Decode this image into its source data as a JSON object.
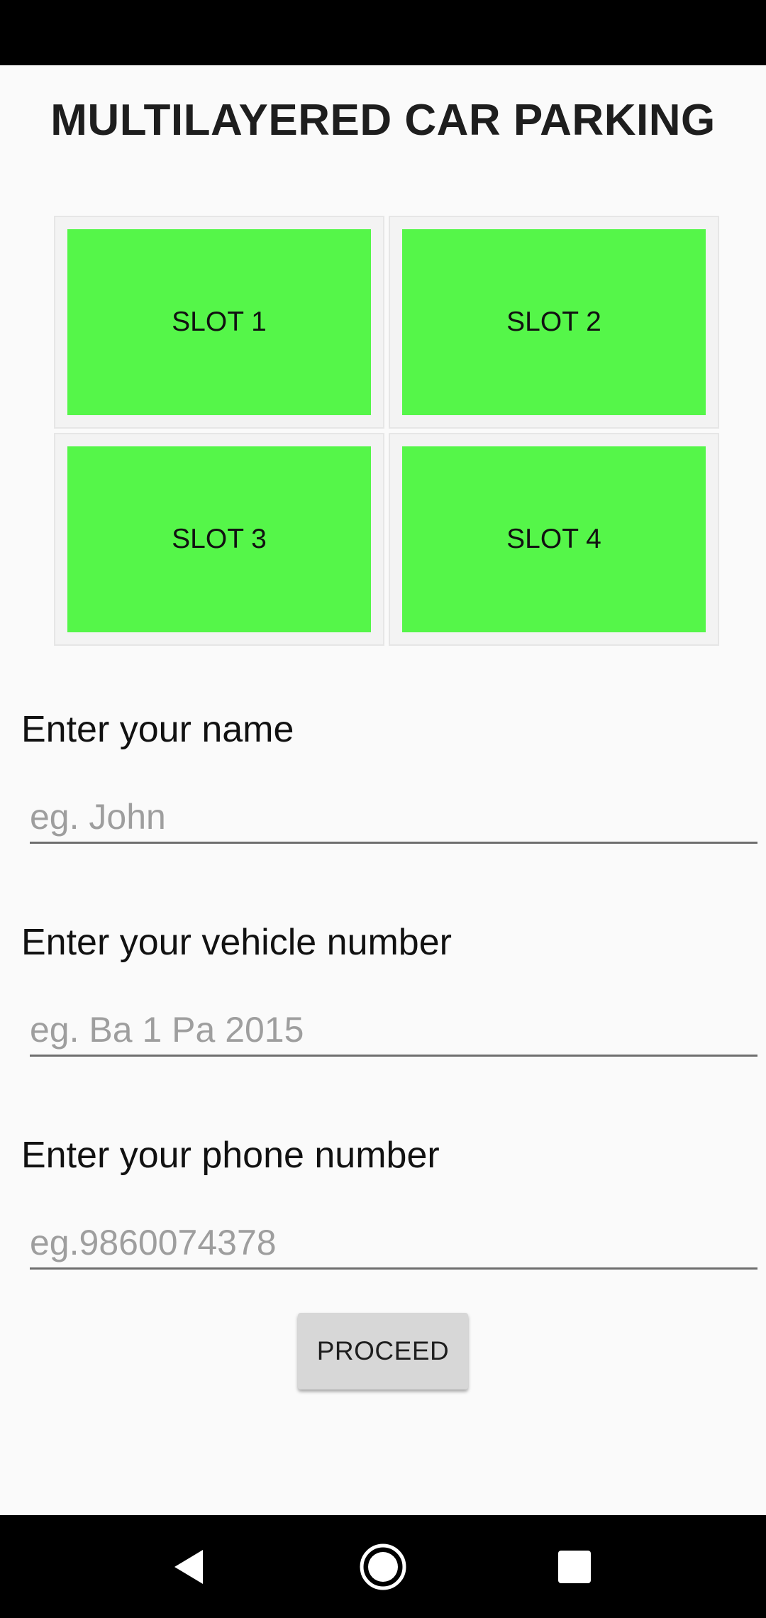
{
  "app": {
    "title": "MULTILAYERED CAR PARKING"
  },
  "slots": [
    {
      "label": "SLOT 1",
      "color": "#55f649"
    },
    {
      "label": "SLOT 2",
      "color": "#55f649"
    },
    {
      "label": "SLOT 3",
      "color": "#55f649"
    },
    {
      "label": "SLOT 4",
      "color": "#55f649"
    }
  ],
  "form": {
    "name": {
      "label": "Enter your name",
      "value": "",
      "placeholder": "eg. John"
    },
    "vehicle": {
      "label": "Enter your vehicle number",
      "value": "",
      "placeholder": "eg. Ba 1 Pa 2015"
    },
    "phone": {
      "label": "Enter your phone number",
      "value": "",
      "placeholder": "eg.9860074378"
    }
  },
  "actions": {
    "proceed_label": "PROCEED"
  },
  "navigation": {
    "back_icon": "back-triangle-icon",
    "home_icon": "home-circle-icon",
    "recents_icon": "recents-square-icon"
  }
}
